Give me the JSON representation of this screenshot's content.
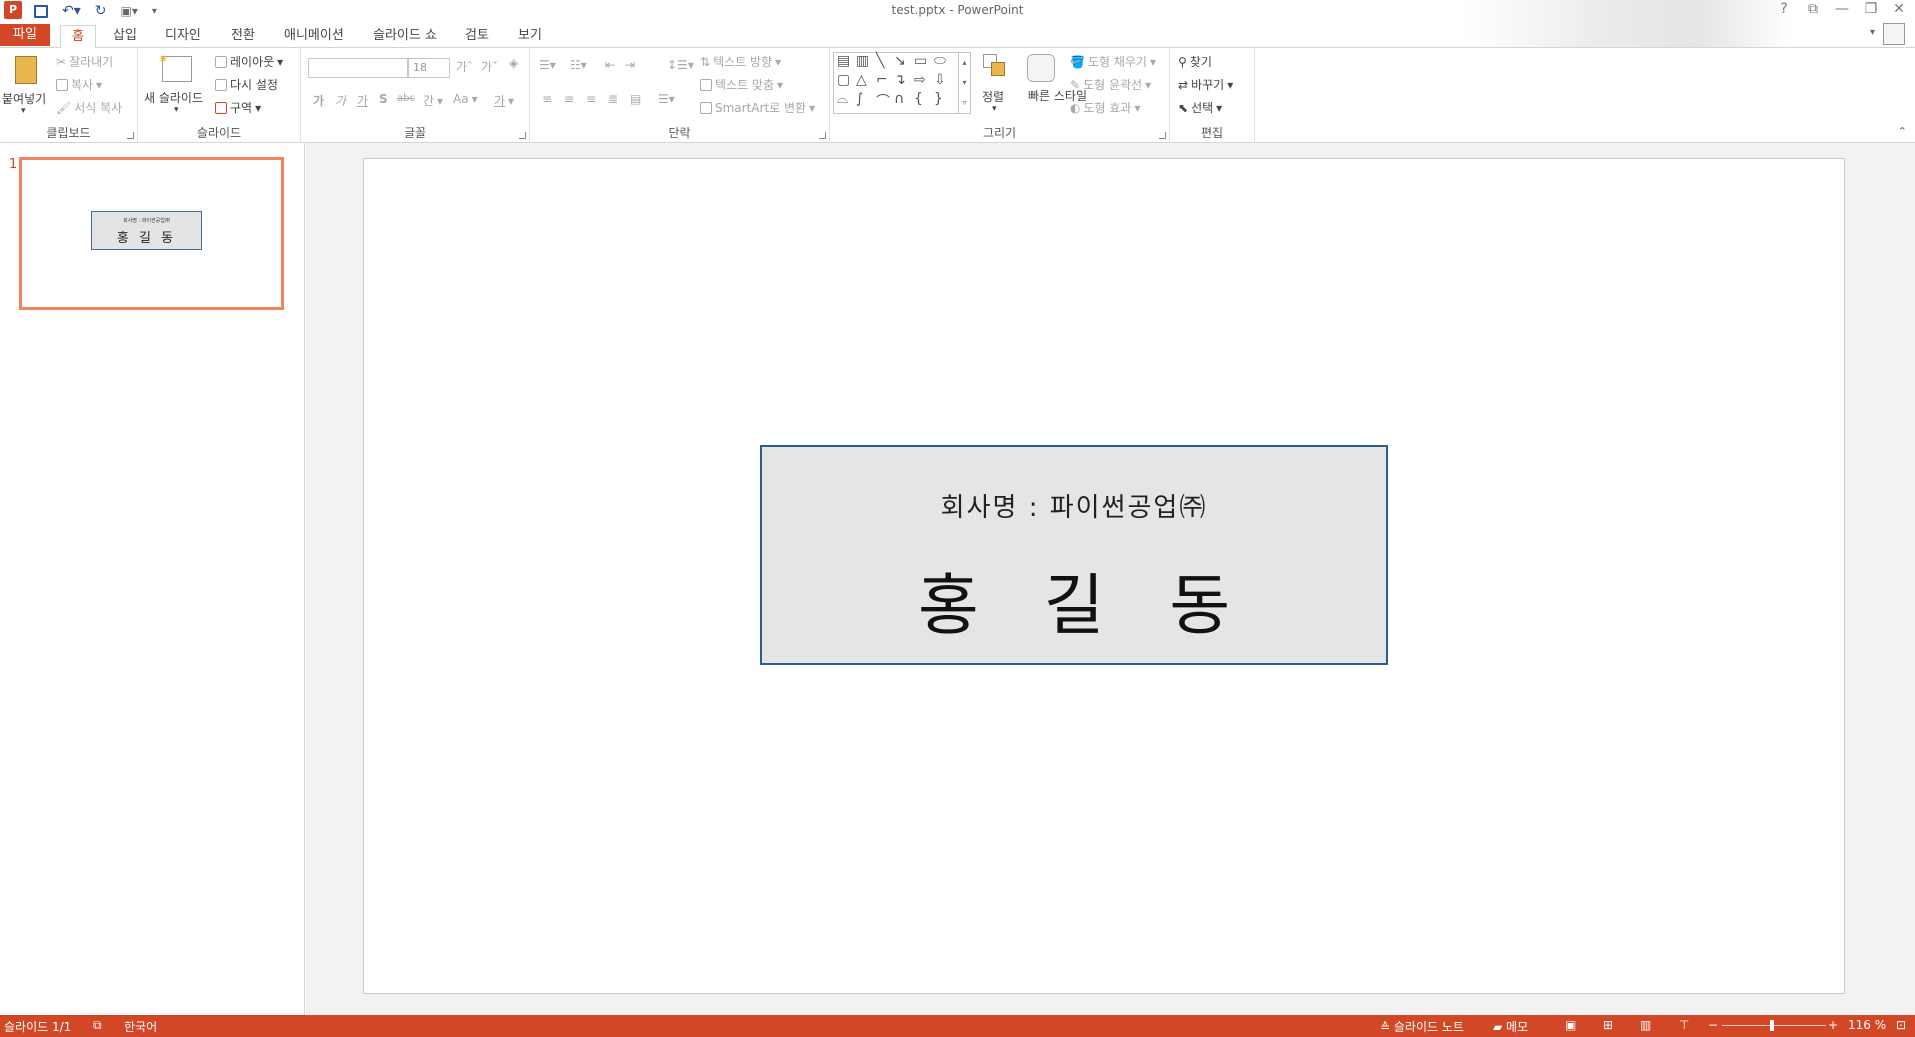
{
  "window": {
    "title": "test.pptx - PowerPoint",
    "controls": [
      "?",
      "⧉",
      "—",
      "❐",
      "✕"
    ]
  },
  "tabs": [
    {
      "label": "파일"
    },
    {
      "label": "홈"
    },
    {
      "label": "삽입"
    },
    {
      "label": "디자인"
    },
    {
      "label": "전환"
    },
    {
      "label": "애니메이션"
    },
    {
      "label": "슬라이드 쇼"
    },
    {
      "label": "검토"
    },
    {
      "label": "보기"
    }
  ],
  "ribbon": {
    "clipboard": {
      "label": "클립보드",
      "paste": "붙여넣기",
      "cut": "잘라내기",
      "copy": "복사",
      "format_painter": "서식 복사"
    },
    "slides": {
      "label": "슬라이드",
      "new_slide": "새 슬라이드",
      "layout": "레이아웃",
      "reset": "다시 설정",
      "section": "구역"
    },
    "font": {
      "label": "글꼴",
      "font_name": "",
      "font_size": "18",
      "bold": "가",
      "italic": "가",
      "underline": "가",
      "shadow": "S",
      "strike": "abc",
      "spacing": "간",
      "case": "Aa",
      "color": "가"
    },
    "paragraph": {
      "label": "단락",
      "text_direction": "텍스트 방향",
      "align_text": "텍스트 맞춤",
      "smartart": "SmartArt로 변환"
    },
    "drawing": {
      "label": "그리기",
      "arrange": "정렬",
      "quick_styles": "빠른 스타일",
      "shape_fill": "도형 채우기",
      "shape_outline": "도형 윤곽선",
      "shape_effects": "도형 효과"
    },
    "editing": {
      "label": "편집",
      "find": "찾기",
      "replace": "바꾸기",
      "select": "선택"
    }
  },
  "slide_panel": {
    "slide_number": "1",
    "thumb_company": "회사명 : 파이썬공업㈜",
    "thumb_name": "홍 길 동"
  },
  "slide": {
    "company": "회사명 : 파이썬공업㈜",
    "person": "홍 길 동"
  },
  "statusbar": {
    "slide_info": "슬라이드 1/1",
    "language": "한국어",
    "notes": "슬라이드 노트",
    "comments": "메모",
    "zoom": "116 %"
  },
  "colors": {
    "accent": "#d24726",
    "textbox_fill": "#e5e5e5",
    "textbox_border": "#2f5d8a"
  }
}
